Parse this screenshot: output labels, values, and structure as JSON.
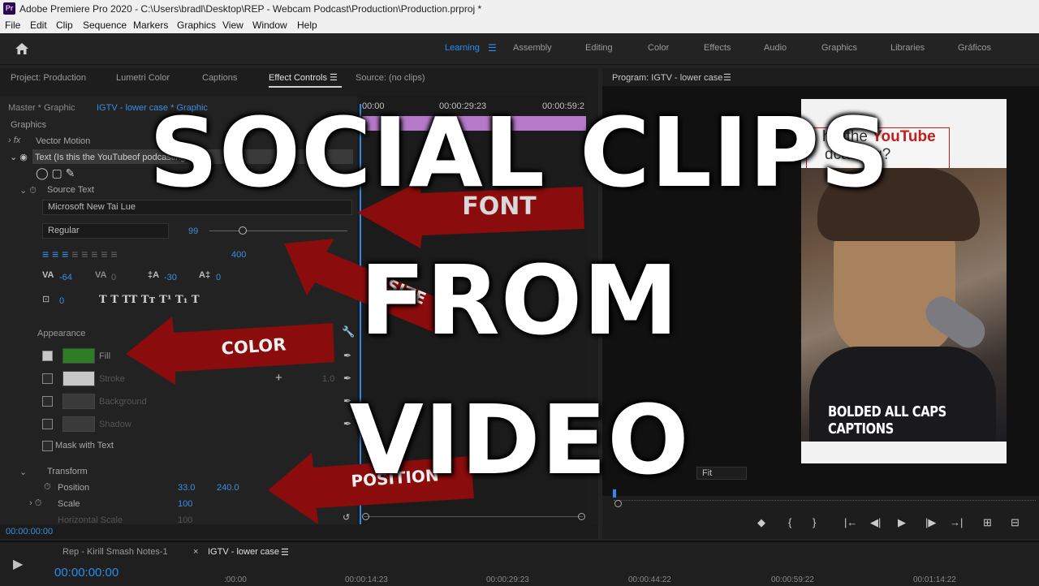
{
  "window": {
    "title": "Adobe Premiere Pro 2020 - C:\\Users\\bradl\\Desktop\\REP - Webcam Podcast\\Production\\Production.prproj *",
    "app_badge": "Pr"
  },
  "menu": [
    "File",
    "Edit",
    "Clip",
    "Sequence",
    "Markers",
    "Graphics",
    "View",
    "Window",
    "Help"
  ],
  "workspaces": {
    "items": [
      "Learning",
      "Assembly",
      "Editing",
      "Color",
      "Effects",
      "Audio",
      "Graphics",
      "Libraries",
      "Gráficos"
    ],
    "active": "Learning"
  },
  "left_tabs": [
    "Project: Production",
    "Lumetri Color",
    "Captions",
    "Effect Controls",
    "Source: (no clips)"
  ],
  "right_tab": "Program: IGTV - lower case",
  "effect_controls": {
    "master": "Master * Graphic",
    "clip": "IGTV - lower case * Graphic",
    "tl_times": [
      "00:00",
      "00:00:29:23",
      "00:00:59:2"
    ],
    "section": "Graphics",
    "vector_motion": "Vector Motion",
    "text_layer": "Text (Is this the YouTubeof podcasting?)",
    "source_text": "Source Text",
    "font": "Microsoft New Tai Lue",
    "style": "Regular",
    "size": "99",
    "size2": "400",
    "tracking": "-64",
    "kerning": "0",
    "leading": "-30",
    "baseline": "0",
    "tsume": "0",
    "style_buttons": "T T TT Tт T¹ T₁ T",
    "appearance": "Appearance",
    "fill": "Fill",
    "stroke": "Stroke",
    "stroke_val": "1.0",
    "background": "Background",
    "shadow": "Shadow",
    "mask": "Mask with Text",
    "transform": "Transform",
    "position": "Position",
    "pos_x": "33.0",
    "pos_y": "240.0",
    "scale": "Scale",
    "scale_val": "100",
    "hscale": "Horizontal Scale",
    "hscale_val": "100",
    "timecode": "00:00:00:00"
  },
  "arrows": {
    "font": "FONT",
    "size": "SIZE",
    "color": "COLOR",
    "position": "POSITION"
  },
  "program": {
    "caption_line1a": "his the ",
    "caption_line1b": "YouTube",
    "caption_line2": "dcasting?",
    "video_caption": "BOLDED ALL CAPS CAPTIONS",
    "fit": "Fit",
    "controls": [
      "◆",
      "{",
      "}",
      "|←",
      "◀|",
      "▶",
      "|▶",
      "→|",
      "⊞",
      "⊟"
    ]
  },
  "timeline": {
    "tab1": "Rep - Kirill Smash Notes-1",
    "tab2": "IGTV - lower case",
    "timecode": "00:00:00:00",
    "ruler": [
      ":00:00",
      "00:00:14:23",
      "00:00:29:23",
      "00:00:44:22",
      "00:00:59:22",
      "00:01:14:22"
    ]
  },
  "overlay": {
    "line1": "SOCIAL CLIPS",
    "line2": "FROM",
    "line3": "VIDEO"
  },
  "colors": {
    "accent": "#2d8ceb",
    "arrow": "#8a0c0c",
    "fill_swatch": "#2e7d25",
    "clip_purple": "#b678c8",
    "caption_red": "#c41d1d"
  }
}
